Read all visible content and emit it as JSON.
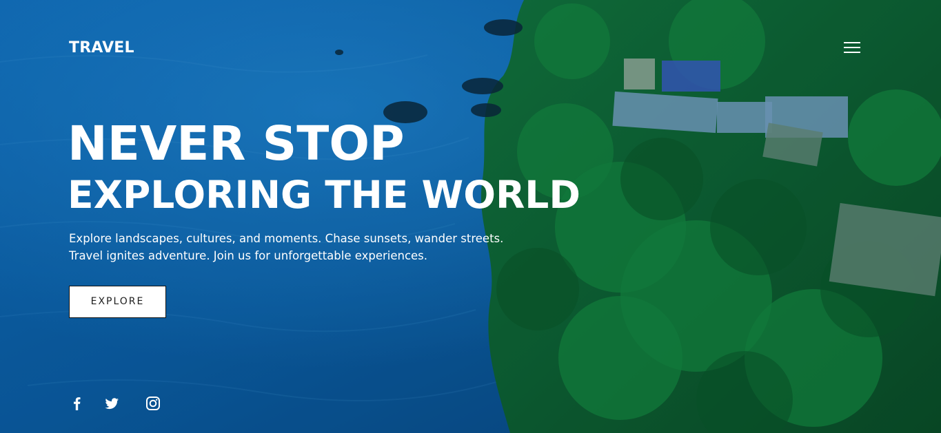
{
  "brand": {
    "logo_text": "TRAVEL"
  },
  "nav": {
    "menu_icon": "hamburger-menu-icon"
  },
  "hero": {
    "headline_line1": "NEVER STOP",
    "headline_line2": "EXPLORING THE WORLD",
    "description_line1": "Explore landscapes, cultures, and moments. Chase sunsets, wander streets.",
    "description_line2": "Travel ignites adventure. Join us for unforgettable experiences.",
    "cta_label": "EXPLORE"
  },
  "social": {
    "icons": [
      "facebook-icon",
      "twitter-icon",
      "instagram-icon"
    ]
  },
  "colors": {
    "text": "#ffffff",
    "button_bg": "#ffffff",
    "button_text": "#1d1d1d",
    "ocean": "#0b67aa",
    "forest": "#0c5e2c"
  }
}
